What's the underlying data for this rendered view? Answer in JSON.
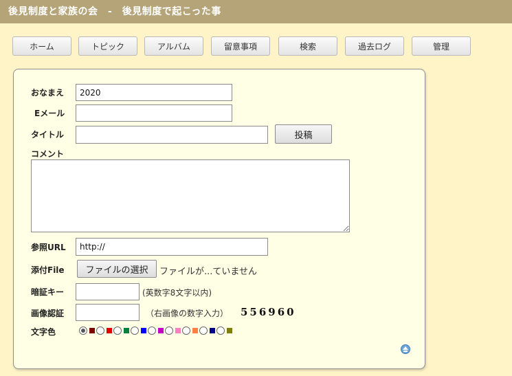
{
  "header": {
    "title": "後見制度と家族の会　-　後見制度で起こった事"
  },
  "nav": {
    "items": [
      {
        "label": "ホーム"
      },
      {
        "label": "トピック"
      },
      {
        "label": "アルバム"
      },
      {
        "label": "留意事項"
      },
      {
        "label": "検索"
      },
      {
        "label": "過去ログ"
      },
      {
        "label": "管理"
      }
    ]
  },
  "form": {
    "name": {
      "label": "おなまえ",
      "value": "2020"
    },
    "email": {
      "label": "Eメール",
      "value": ""
    },
    "title": {
      "label": "タイトル",
      "value": ""
    },
    "submit_label": "投稿",
    "comment": {
      "label": "コメント",
      "value": ""
    },
    "url": {
      "label": "参照URL",
      "value": "http://"
    },
    "file": {
      "label": "添付File",
      "button_label": "ファイルの選択",
      "status": "ファイルが...ていません"
    },
    "password": {
      "label": "暗証キー",
      "value": "",
      "hint": "(英数字8文字以内)"
    },
    "captcha": {
      "label": "画像認証",
      "value": "",
      "hint": "（右画像の数字入力）",
      "code": "556960"
    },
    "text_color": {
      "label": "文字色",
      "selected_index": 0,
      "colors": [
        "#800000",
        "#df0000",
        "#008040",
        "#0000ff",
        "#c100c1",
        "#ff80c0",
        "#ff8040",
        "#000080",
        "#808000"
      ]
    }
  },
  "back_to_top_icon": "arrow-up-circle-icon"
}
